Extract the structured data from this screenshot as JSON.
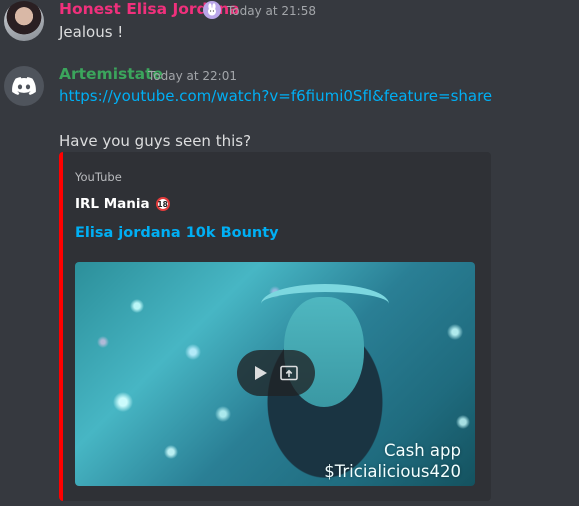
{
  "messages": [
    {
      "username": "Honest Elisa Jordana",
      "username_color": "#f0307c",
      "timestamp": "Today at 21:58",
      "text": "Jealous !"
    },
    {
      "username": "Artemistate",
      "username_color": "#3ba55c",
      "timestamp": "Today at 22:01",
      "link": "https://youtube.com/watch?v=f6fiumi0SfI&feature=share",
      "text": "Have you guys seen this?",
      "embed": {
        "provider": "YouTube",
        "author": "IRL Mania",
        "age_badge": "18",
        "title": "Elisa jordana 10k Bounty",
        "accent_color": "#ff0000",
        "video_caption_line1": "Cash app",
        "video_caption_line2": "$Tricialicious420"
      }
    }
  ]
}
